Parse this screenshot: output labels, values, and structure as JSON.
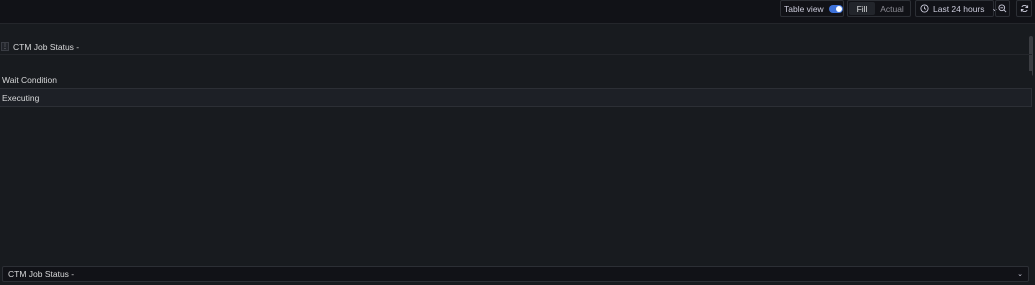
{
  "toolbar": {
    "table_view_label": "Table view",
    "table_view_enabled": true,
    "fill_label": "Fill",
    "actual_label": "Actual",
    "time_range_label": "Last 24 hours"
  },
  "table": {
    "header": "CTM Job Status -",
    "rows": [
      "Wait Condition",
      "Executing"
    ]
  },
  "bottom_select": {
    "value": "CTM Job Status -"
  },
  "colors": {
    "background": "#181b1f",
    "toolbar": "#111217",
    "accent": "#3d71d9"
  }
}
